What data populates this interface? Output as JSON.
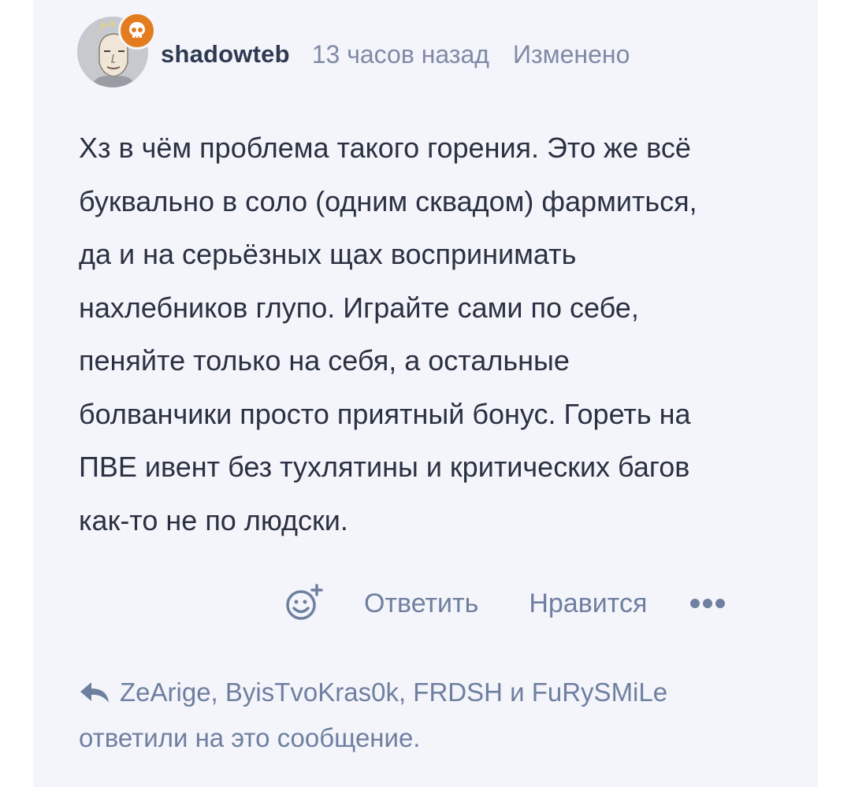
{
  "comment": {
    "author": "shadowteb",
    "timestamp": "13 часов назад",
    "edited_label": "Изменено",
    "avatar_icon": "user-avatar",
    "badge_icon": "skull-icon",
    "badge_color": "#e37c1e",
    "text": "Хз в чём проблема такого горения. Это же всё\nбуквально в соло (одним сквадом) фармиться,\nда и на серьёзных щах воспринимать\nнахлебников глупо. Играйте сами по себе,\nпеняйте только на себя, а остальные\nболванчики просто приятный бонус. Гореть на\nПВЕ ивент без тухлятины и критических багов\nкак-то не по людски."
  },
  "actions": {
    "react_icon": "add-reaction-icon",
    "reply_label": "Ответить",
    "like_label": "Нравится",
    "more_icon": "more-dots-icon"
  },
  "replies": {
    "icon": "reply-arrow-icon",
    "names": "ZeArige, ByisTvoKras0k, FRDSH и FuRySMiLe",
    "suffix": "ответили на это сообщение."
  },
  "colors": {
    "card_background": "#f4f5fa",
    "text": "#2a3142",
    "muted": "#7f8aa6",
    "link": "#6f7fa0"
  }
}
